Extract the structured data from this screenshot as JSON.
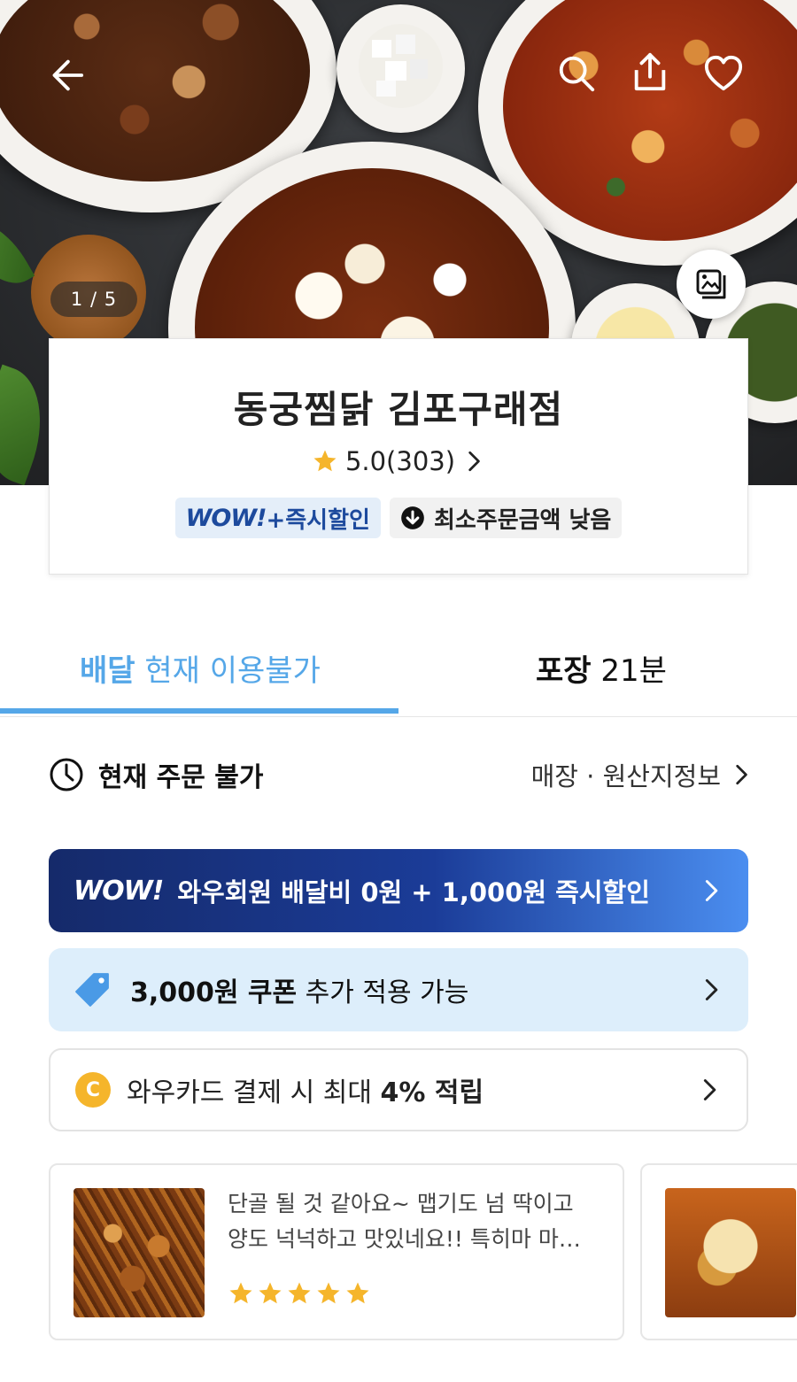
{
  "hero": {
    "counter": "1 / 5"
  },
  "store": {
    "name": "동궁찜닭 김포구래점",
    "rating": "5.0(303)",
    "badge_wow_logo": "WOW!",
    "badge_wow_text": "+즉시할인",
    "badge_minorder": "최소주문금액 낮음"
  },
  "tabs": {
    "delivery_bold": "배달",
    "delivery_rest": " 현재 이용불가",
    "pickup_bold": "포장",
    "pickup_rest": " 21분"
  },
  "status": {
    "left": "현재 주문 불가",
    "right": "매장 · 원산지정보"
  },
  "promos": {
    "wow_logo": "WOW!",
    "wow_text": "와우회원 배달비 0원 + 1,000원 즉시할인",
    "coupon_bold": "3,000원 쿠폰",
    "coupon_rest": " 추가 적용 가능",
    "card_coin": "C",
    "card_pre": "와우카드 결제 시 최대 ",
    "card_bold": "4% 적립"
  },
  "reviews": [
    {
      "text": "단골 될 것 같아요~ 맵기도 넘 딱이고 양도 넉넉하고 맛있네요!! 특히마 마…",
      "stars": 5
    }
  ],
  "colors": {
    "accent": "#55a7e8",
    "wow_dark": "#152a6a",
    "coupon_bg": "#ddeefb",
    "star": "#f5b52b"
  }
}
